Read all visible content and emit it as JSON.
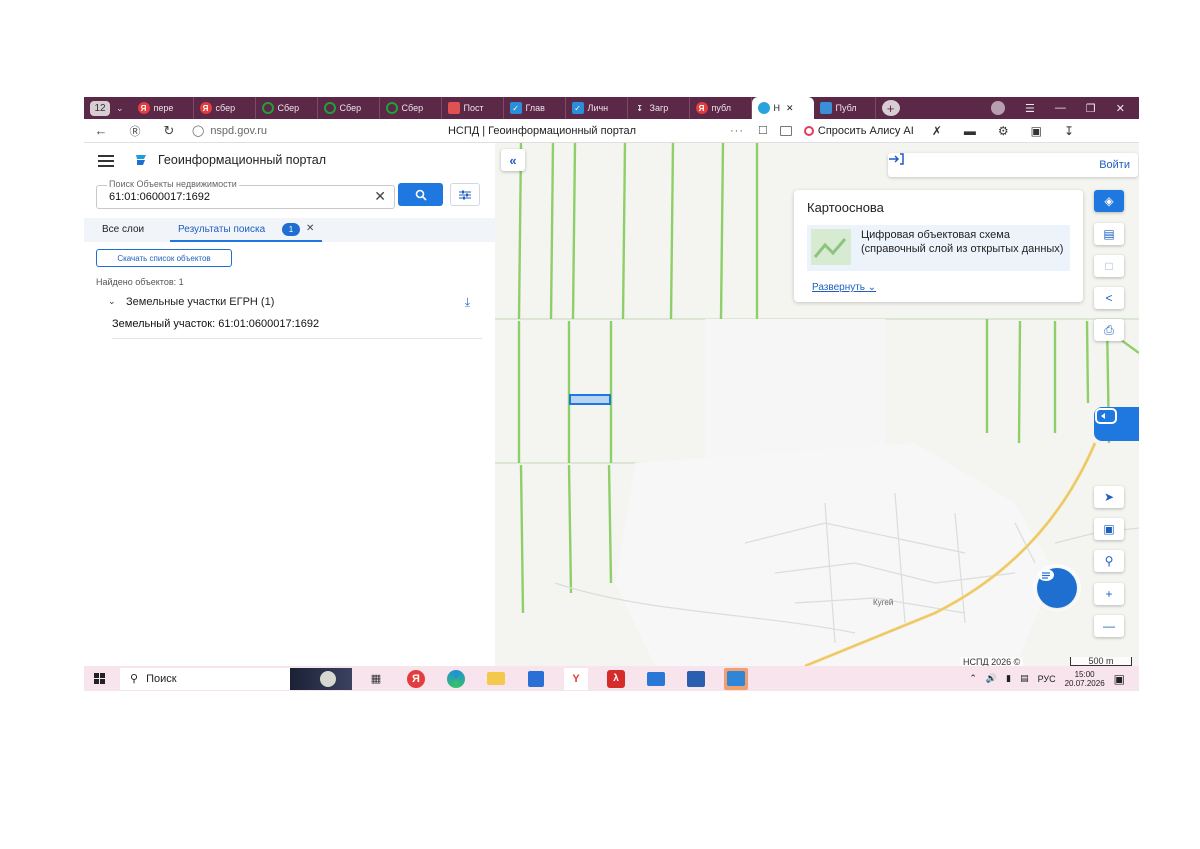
{
  "browser": {
    "tab_count": "12",
    "tabs": [
      {
        "label": "пере",
        "icon": "yandex-icon",
        "color": "#e33d3d"
      },
      {
        "label": "сбер",
        "icon": "yandex-icon",
        "color": "#e33d3d"
      },
      {
        "label": "Сбер",
        "icon": "sber-icon",
        "color": "#21a038"
      },
      {
        "label": "Сбер",
        "icon": "sber-icon",
        "color": "#21a038"
      },
      {
        "label": "Сбер",
        "icon": "sber-icon",
        "color": "#21a038"
      },
      {
        "label": "Пост",
        "icon": "doc-icon",
        "color": "#e05252"
      },
      {
        "label": "Глав",
        "icon": "mail-icon",
        "color": "#2a8fd6"
      },
      {
        "label": "Личн",
        "icon": "mail-icon",
        "color": "#2a8fd6"
      },
      {
        "label": "Загр",
        "icon": "download-icon",
        "color": "#cccccc"
      },
      {
        "label": "публ",
        "icon": "yandex-icon",
        "color": "#e33d3d"
      },
      {
        "label": "Н",
        "icon": "nspd-icon",
        "color": "#29a3e0",
        "active": true
      },
      {
        "label": "Публ",
        "icon": "map-icon",
        "color": "#3a8fd6"
      }
    ],
    "url": "nspd.gov.ru",
    "page_title": "НСПД | Геоинформационный портал",
    "alice_label": "Спросить Алису AI"
  },
  "portal": {
    "title": "Геоинформационный портал",
    "search": {
      "label": "Поиск Объекты недвижимости",
      "value": "61:01:0600017:1692"
    },
    "tabs": {
      "all_layers": "Все слои",
      "results": "Результаты поиска",
      "results_count": "1"
    },
    "download_list": "Скачать список объектов",
    "found_text": "Найдено объектов: 1",
    "group": {
      "name": "Земельные участки ЕГРН (1)"
    },
    "result_item": "Земельный участок: 61:01:0600017:1692"
  },
  "map": {
    "login": "Войти",
    "basemap": {
      "title": "Картооснова",
      "layer_name": "Цифровая объектовая схема (справочный слой из открытых данных)",
      "expand": "Развернуть"
    },
    "place_label": "Кугей",
    "attribution": "НСПД 2026 ©",
    "scale": "500 m",
    "colors": {
      "field_lines": "#8fcf6a",
      "selection": "#1f78e0",
      "road": "#f2d27a",
      "accent": "#1f78e0"
    }
  },
  "taskbar": {
    "search_label": "Поиск",
    "lang": "РУС",
    "time": "15:00",
    "date": "20.07.2026"
  }
}
